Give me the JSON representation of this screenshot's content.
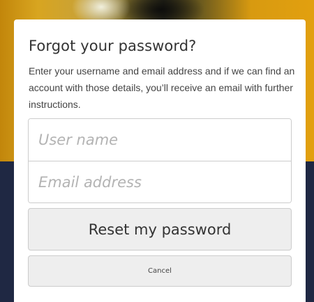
{
  "dialog": {
    "title": "Forgot your password?",
    "description": "Enter your username and email address and if we can find an account with those details, you’ll receive an email with further instructions."
  },
  "form": {
    "username_placeholder": "User name",
    "username_value": "",
    "email_placeholder": "Email address",
    "email_value": ""
  },
  "actions": {
    "reset_label": "Reset my password",
    "cancel_label": "Cancel"
  },
  "colors": {
    "background_navy": "#1f2843",
    "background_gold": "#d89a10",
    "card": "#ffffff",
    "button_bg": "#eeeeee",
    "border": "#cccccc"
  }
}
